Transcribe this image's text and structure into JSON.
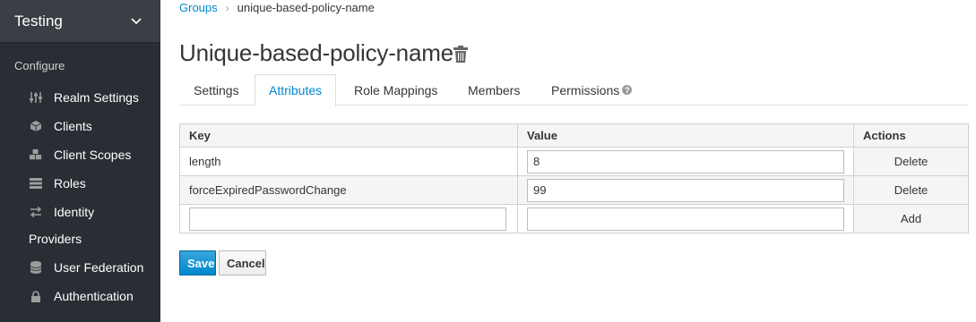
{
  "sidebar": {
    "realm": "Testing",
    "section": "Configure",
    "items": [
      {
        "label": "Realm Settings",
        "icon": "sliders-icon"
      },
      {
        "label": "Clients",
        "icon": "cube-icon"
      },
      {
        "label": "Client Scopes",
        "icon": "cubes-icon"
      },
      {
        "label": "Roles",
        "icon": "list-icon"
      },
      {
        "label": "Identity",
        "icon": "exchange-icon"
      },
      {
        "label": "Providers",
        "icon": ""
      },
      {
        "label": "User Federation",
        "icon": "database-icon"
      },
      {
        "label": "Authentication",
        "icon": "lock-icon"
      }
    ]
  },
  "breadcrumb": {
    "parent": "Groups",
    "current": "unique-based-policy-name"
  },
  "page": {
    "title": "Unique-based-policy-name"
  },
  "tabs": [
    {
      "label": "Settings",
      "active": false
    },
    {
      "label": "Attributes",
      "active": true
    },
    {
      "label": "Role Mappings",
      "active": false
    },
    {
      "label": "Members",
      "active": false
    },
    {
      "label": "Permissions",
      "active": false
    }
  ],
  "table": {
    "headers": [
      "Key",
      "Value",
      "Actions"
    ],
    "rows": [
      {
        "key": "length",
        "value": "8",
        "action": "Delete"
      },
      {
        "key": "forceExpiredPasswordChange",
        "value": "99",
        "action": "Delete"
      }
    ],
    "new_row": {
      "key": "",
      "value": "",
      "action": "Add"
    }
  },
  "buttons": {
    "save": "Save",
    "cancel": "Cancel"
  },
  "colors": {
    "sidebar_bg": "#292e34",
    "accent": "#0088ce"
  }
}
